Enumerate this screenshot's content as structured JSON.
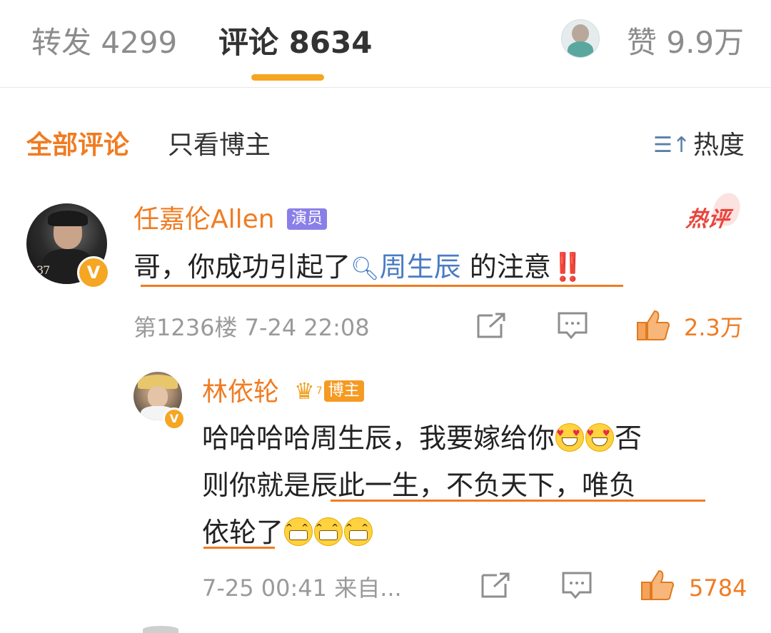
{
  "tabs": {
    "repost": "转发 4299",
    "comment": "评论 8634",
    "like": "赞 9.9万"
  },
  "filters": {
    "all": "全部评论",
    "owner_only": "只看博主",
    "sort": "热度"
  },
  "comment": {
    "author": "任嘉伦Allen",
    "author_badge": "演员",
    "hot_label": "热评",
    "avatar_caption": "37",
    "text_before": "哥，你成功引起了",
    "mention": "周生辰",
    "text_after": " 的注意",
    "text_mark": "‼️",
    "meta": "第1236楼  7-24 22:08",
    "likes": "2.3万"
  },
  "reply": {
    "author": "林依轮",
    "author_badge": "博主",
    "crown_level": "7",
    "line1": "哈哈哈哈周生辰，我要嫁给你",
    "line1_tail": "否",
    "line2": "则你就是辰此一生，不负天下，唯负",
    "line3": "依轮了",
    "meta": "7-25 00:41  来自...",
    "likes": "5784"
  },
  "icons": {
    "repost": "share-icon",
    "comment": "comment-icon",
    "like": "thumbs-up-icon",
    "sort": "sort-icon",
    "search": "search-icon"
  },
  "colors": {
    "accent": "#f07c22",
    "tab_underline": "#f5a623",
    "link": "#4a7cc4",
    "actor_badge": "#8a7fe8",
    "hot": "#e8453c"
  }
}
